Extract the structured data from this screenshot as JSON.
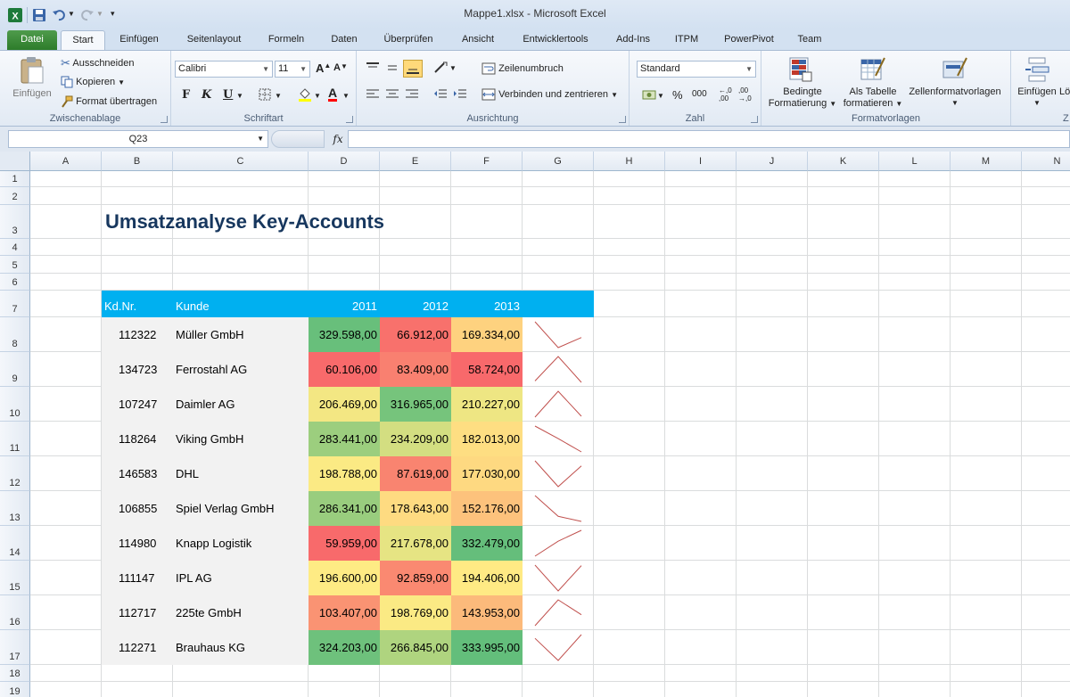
{
  "window": {
    "title": "Mappe1.xlsx - Microsoft Excel"
  },
  "tabs": [
    "Datei",
    "Start",
    "Einfügen",
    "Seitenlayout",
    "Formeln",
    "Daten",
    "Überprüfen",
    "Ansicht",
    "Entwicklertools",
    "Add-Ins",
    "ITPM",
    "PowerPivot",
    "Team"
  ],
  "ribbon": {
    "clipboard": {
      "label": "Zwischenablage",
      "paste": "Einfügen",
      "cut": "Ausschneiden",
      "copy": "Kopieren",
      "format_painter": "Format übertragen"
    },
    "font": {
      "label": "Schriftart",
      "name": "Calibri",
      "size": "11",
      "bold": "F",
      "italic": "K",
      "underline": "U"
    },
    "alignment": {
      "label": "Ausrichtung",
      "wrap": "Zeilenumbruch",
      "merge": "Verbinden und zentrieren"
    },
    "number": {
      "label": "Zahl",
      "format": "Standard",
      "percent": "%",
      "thousands": "000"
    },
    "styles": {
      "label": "Formatvorlagen",
      "cond_format_1": "Bedingte",
      "cond_format_2": "Formatierung",
      "as_table_1": "Als Tabelle",
      "as_table_2": "formatieren",
      "cell_styles": "Zellenformatvorlagen"
    },
    "cells": {
      "insert": "Einfügen",
      "insert_cut": "Lö",
      "label_cut": "Z"
    }
  },
  "formula_bar": {
    "name_box": "Q23",
    "fx": "fx",
    "formula": ""
  },
  "columns": [
    "A",
    "B",
    "C",
    "D",
    "E",
    "F",
    "G",
    "H",
    "I",
    "J",
    "K",
    "L",
    "M",
    "N"
  ],
  "rows": [
    "1",
    "2",
    "3",
    "4",
    "5",
    "6",
    "7",
    "8",
    "9",
    "10",
    "11",
    "12",
    "13",
    "14",
    "15",
    "16",
    "17",
    "18",
    "19"
  ],
  "sheet": {
    "title": "Umsatzanalyse Key-Accounts",
    "headers": {
      "id": "Kd.Nr.",
      "customer": "Kunde",
      "y2011": "2011",
      "y2012": "2012",
      "y2013": "2013"
    },
    "records": [
      {
        "id": "112322",
        "customer": "Müller GmbH",
        "v2011": "329.598,00",
        "v2012": "66.912,00",
        "v2013": "169.334,00",
        "n": [
          329598,
          66912,
          169334
        ]
      },
      {
        "id": "134723",
        "customer": "Ferrostahl AG",
        "v2011": "60.106,00",
        "v2012": "83.409,00",
        "v2013": "58.724,00",
        "n": [
          60106,
          83409,
          58724
        ]
      },
      {
        "id": "107247",
        "customer": "Daimler AG",
        "v2011": "206.469,00",
        "v2012": "316.965,00",
        "v2013": "210.227,00",
        "n": [
          206469,
          316965,
          210227
        ]
      },
      {
        "id": "118264",
        "customer": "Viking GmbH",
        "v2011": "283.441,00",
        "v2012": "234.209,00",
        "v2013": "182.013,00",
        "n": [
          283441,
          234209,
          182013
        ]
      },
      {
        "id": "146583",
        "customer": "DHL",
        "v2011": "198.788,00",
        "v2012": "87.619,00",
        "v2013": "177.030,00",
        "n": [
          198788,
          87619,
          177030
        ]
      },
      {
        "id": "106855",
        "customer": "Spiel Verlag GmbH",
        "v2011": "286.341,00",
        "v2012": "178.643,00",
        "v2013": "152.176,00",
        "n": [
          286341,
          178643,
          152176
        ]
      },
      {
        "id": "114980",
        "customer": "Knapp Logistik",
        "v2011": "59.959,00",
        "v2012": "217.678,00",
        "v2013": "332.479,00",
        "n": [
          59959,
          217678,
          332479
        ]
      },
      {
        "id": "111147",
        "customer": "IPL AG",
        "v2011": "196.600,00",
        "v2012": "92.859,00",
        "v2013": "194.406,00",
        "n": [
          196600,
          92859,
          194406
        ]
      },
      {
        "id": "112717",
        "customer": "225te GmbH",
        "v2011": "103.407,00",
        "v2012": "198.769,00",
        "v2013": "143.953,00",
        "n": [
          103407,
          198769,
          143953
        ]
      },
      {
        "id": "112271",
        "customer": "Brauhaus KG",
        "v2011": "324.203,00",
        "v2012": "266.845,00",
        "v2013": "333.995,00",
        "n": [
          324203,
          266845,
          333995
        ]
      }
    ]
  },
  "colors": {
    "header_band": "#00b0f0",
    "title": "#17375e",
    "sparkline": "#c0504d",
    "scale_low": "#f8696b",
    "scale_mid": "#ffeb84",
    "scale_high": "#63be7b",
    "key_fill": "#f2f2f2"
  }
}
